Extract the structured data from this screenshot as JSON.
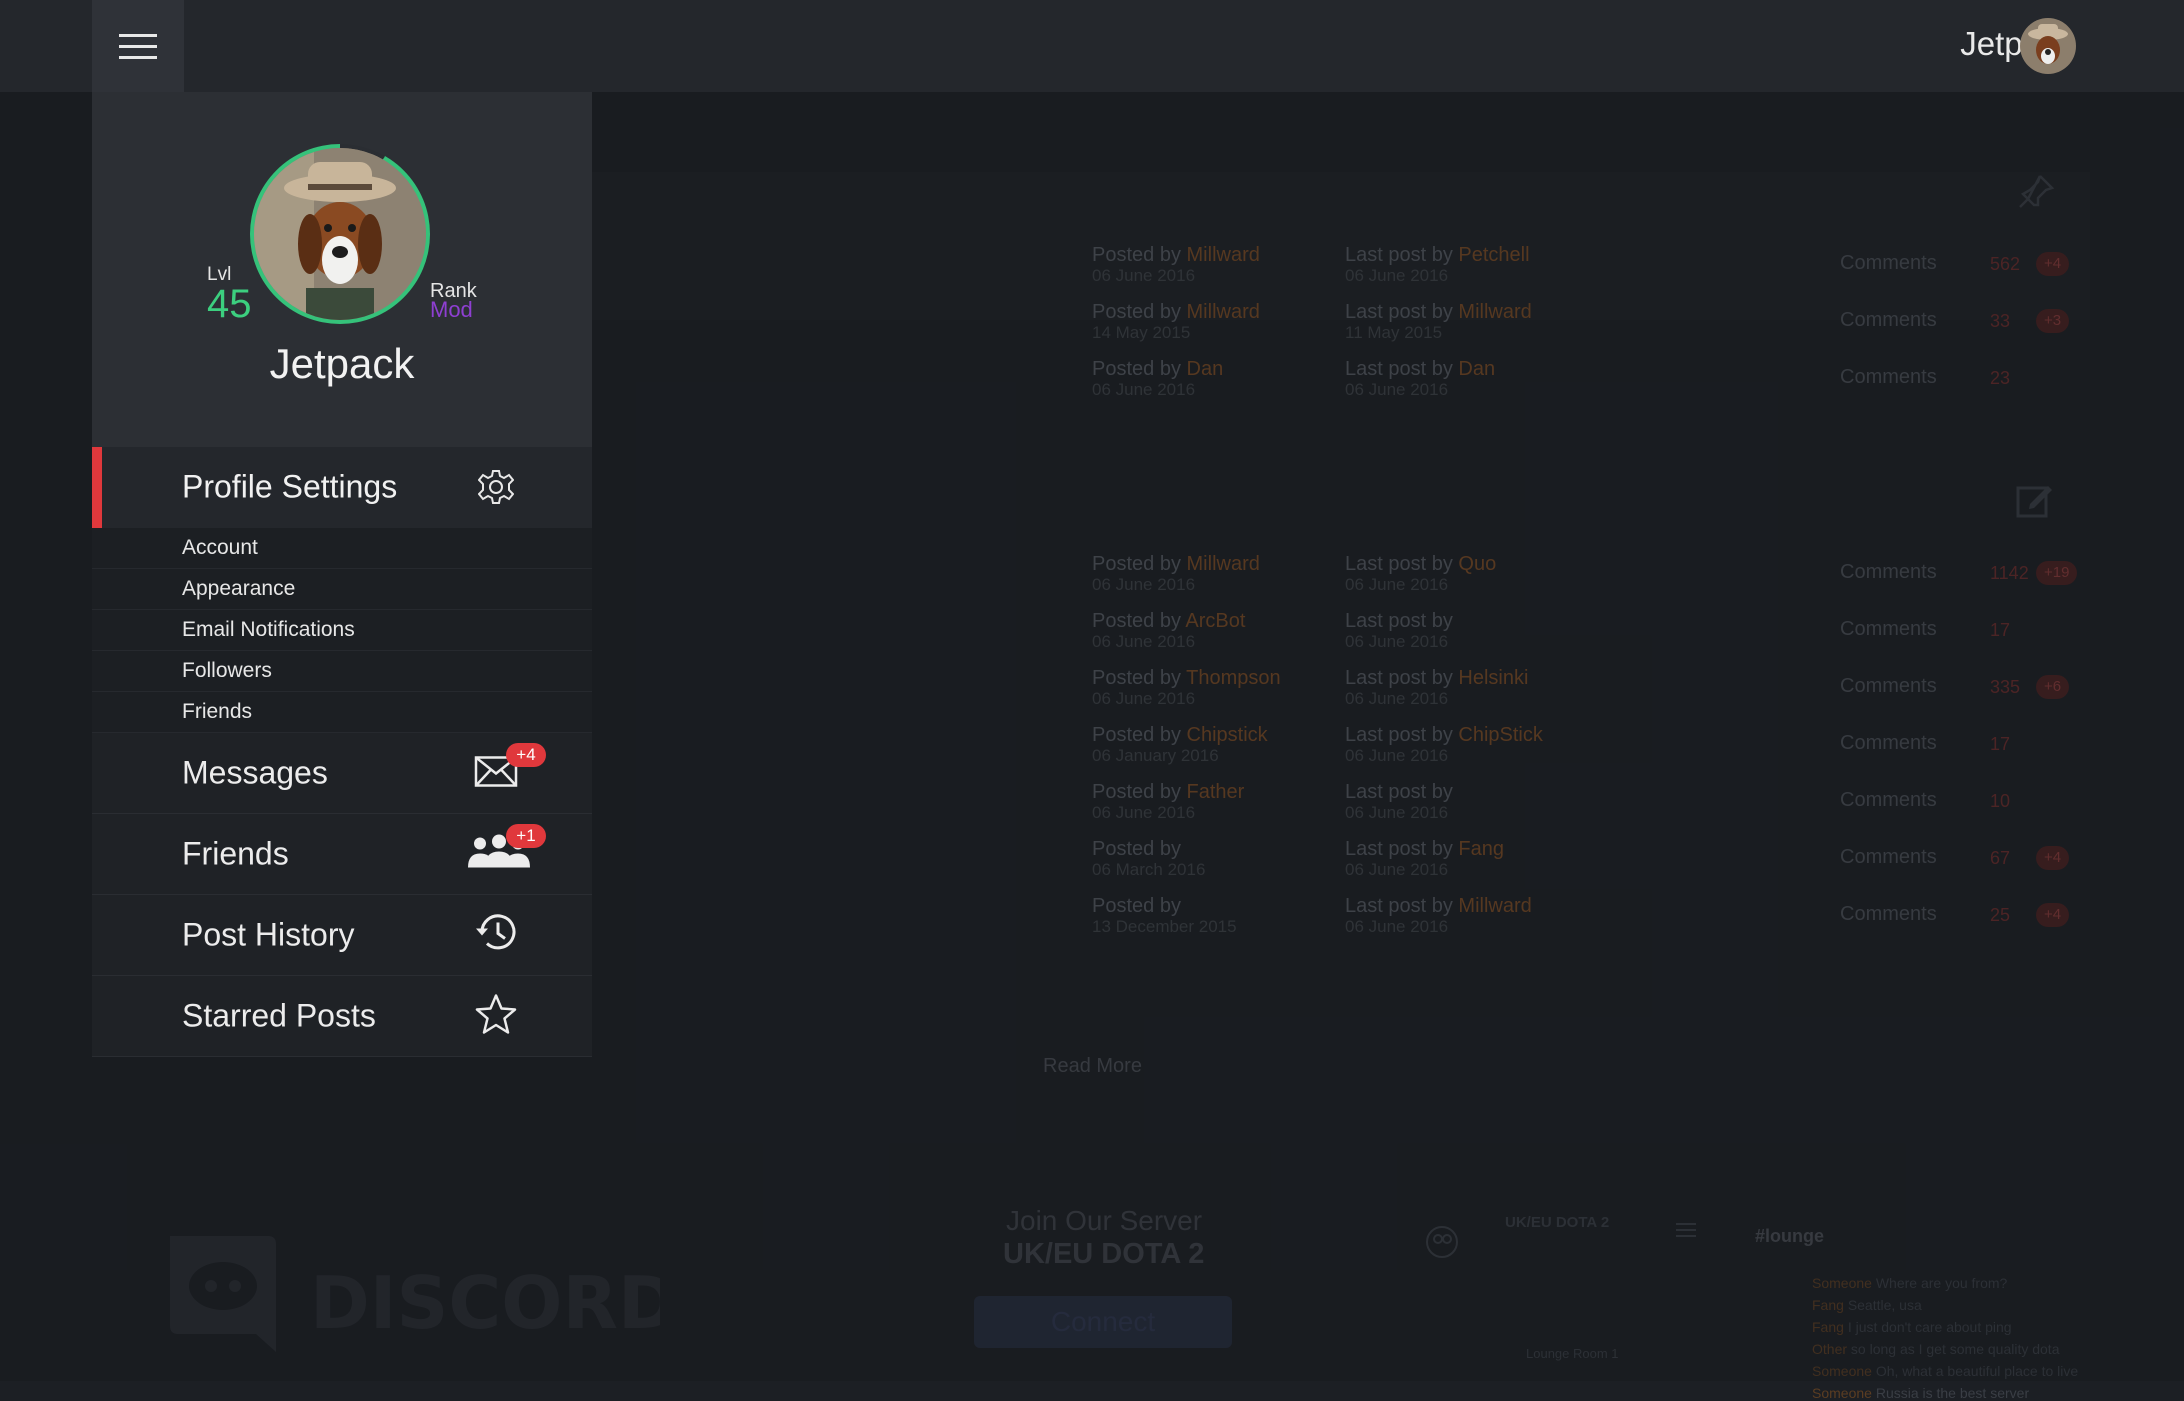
{
  "topbar": {
    "username": "Jetpack",
    "menu_icon": "hamburger-icon",
    "avatar_icon": "avatar"
  },
  "profile": {
    "level_label": "Lvl",
    "level": "45",
    "rank_label": "Rank",
    "rank": "Mod",
    "name": "Jetpack",
    "level_progress": 0.92,
    "colors": {
      "level": "#3ccf7f",
      "rank": "#8e3fd1",
      "ring": "#35c27a"
    }
  },
  "sidebar": {
    "profile_settings": {
      "label": "Profile Settings",
      "icon": "gear-icon",
      "accent": "#e0383c"
    },
    "settings_items": [
      {
        "label": "Account"
      },
      {
        "label": "Appearance"
      },
      {
        "label": "Email Notifications"
      },
      {
        "label": "Followers"
      },
      {
        "label": "Friends"
      }
    ],
    "menu": [
      {
        "label": "Messages",
        "icon": "envelope-icon",
        "badge": "+4"
      },
      {
        "label": "Friends",
        "icon": "users-icon",
        "badge": "+1"
      },
      {
        "label": "Post History",
        "icon": "history-icon",
        "badge": ""
      },
      {
        "label": "Starred Posts",
        "icon": "star-icon",
        "badge": ""
      }
    ]
  },
  "forum": {
    "pinned": [
      {
        "posted_by": "Posted by",
        "author": "Millward",
        "posted_date": "06 June 2016",
        "last_post_by": "Last post by",
        "last_author": "Petchell",
        "last_date": "06 June 2016",
        "comments_label": "Comments",
        "count": "562",
        "new": "+4"
      },
      {
        "posted_by": "Posted by",
        "author": "Millward",
        "posted_date": "14 May 2015",
        "last_post_by": "Last post by",
        "last_author": "Millward",
        "last_date": "11 May 2015",
        "comments_label": "Comments",
        "count": "33",
        "new": "+3"
      },
      {
        "posted_by": "Posted by",
        "author": "Dan",
        "posted_date": "06 June 2016",
        "last_post_by": "Last post by",
        "last_author": "Dan",
        "last_date": "06 June 2016",
        "comments_label": "Comments",
        "count": "23",
        "new": ""
      }
    ],
    "recent": [
      {
        "posted_by": "Posted by",
        "author": "Millward",
        "posted_date": "06 June 2016",
        "last_post_by": "Last post by",
        "last_author": "Quo",
        "last_date": "06 June 2016",
        "comments_label": "Comments",
        "count": "1142",
        "new": "+19"
      },
      {
        "posted_by": "Posted by",
        "author": "ArcBot",
        "posted_date": "06 June 2016",
        "last_post_by": "Last post by",
        "last_author": "",
        "last_date": "06 June 2016",
        "comments_label": "Comments",
        "count": "17",
        "new": ""
      },
      {
        "posted_by": "Posted by",
        "author": "Thompson",
        "posted_date": "06 June 2016",
        "last_post_by": "Last post by",
        "last_author": "Helsinki",
        "last_date": "06 June 2016",
        "comments_label": "Comments",
        "count": "335",
        "new": "+6"
      },
      {
        "posted_by": "Posted by",
        "author": "Chipstick",
        "posted_date": "06 January 2016",
        "last_post_by": "Last post by",
        "last_author": "ChipStick",
        "last_date": "06 June 2016",
        "comments_label": "Comments",
        "count": "17",
        "new": ""
      },
      {
        "posted_by": "Posted by",
        "author": "Father",
        "posted_date": "06 June 2016",
        "last_post_by": "Last post by",
        "last_author": "",
        "last_date": "06 June 2016",
        "comments_label": "Comments",
        "count": "10",
        "new": ""
      },
      {
        "posted_by": "Posted by",
        "author": "",
        "posted_date": "06 March 2016",
        "last_post_by": "Last post by",
        "last_author": "Fang",
        "last_date": "06 June 2016",
        "comments_label": "Comments",
        "count": "67",
        "new": "+4"
      },
      {
        "posted_by": "Posted by",
        "author": "",
        "posted_date": "13 December 2015",
        "last_post_by": "Last post by",
        "last_author": "Millward",
        "last_date": "06 June 2016",
        "comments_label": "Comments",
        "count": "25",
        "new": "+4"
      }
    ],
    "read_more": "Read More"
  },
  "discord": {
    "logo_text": "DISCORD",
    "join": "Join Our Server",
    "server": "UK/EU DOTA 2",
    "connect": "Connect",
    "panel_title": "UK/EU DOTA 2",
    "channel": "Lounge Room 1",
    "lounge_title": "#lounge",
    "chat": [
      {
        "user": "Someone",
        "text": "Where are you from?"
      },
      {
        "user": "Fang",
        "text": "Seattle, usa"
      },
      {
        "user": "Fang",
        "text": "I just don't care about ping"
      },
      {
        "user": "Other",
        "text": "so long as I get some quality dota"
      },
      {
        "user": "Someone",
        "text": "Oh, what a beautiful place to live"
      },
      {
        "user": "Someone",
        "text": "Russia is the best server"
      }
    ]
  }
}
